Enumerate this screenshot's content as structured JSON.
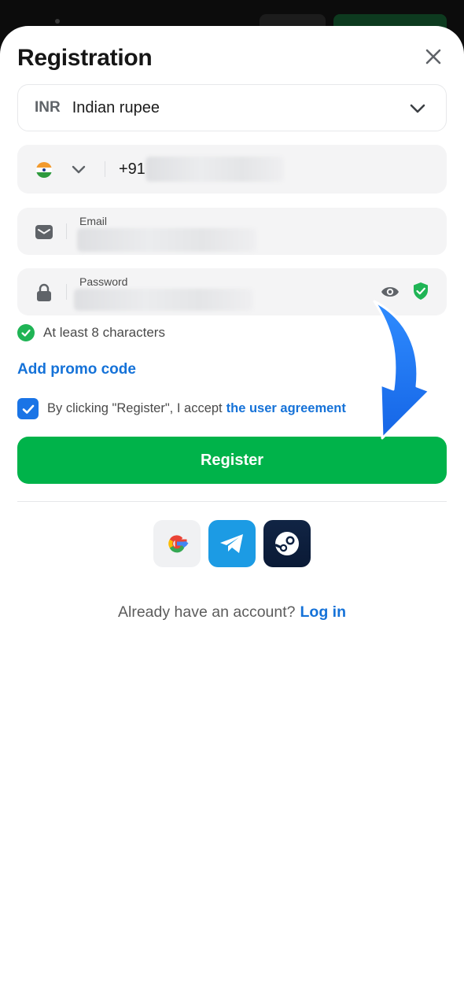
{
  "title": "Registration",
  "currency": {
    "code": "INR",
    "name": "Indian rupee"
  },
  "phone": {
    "dial_code": "+91"
  },
  "email": {
    "label": "Email"
  },
  "password": {
    "label": "Password"
  },
  "hint": {
    "text": "At least 8 characters"
  },
  "promo_label": "Add promo code",
  "agreement": {
    "text": "By clicking \"Register\", I accept",
    "link": "the user agreement",
    "checked": true
  },
  "register_label": "Register",
  "social": [
    "google-icon",
    "telegram-icon",
    "steam-icon"
  ],
  "login": {
    "prompt": "Already have an account?",
    "link": "Log in"
  },
  "colors": {
    "primary_green": "#00b34a",
    "link_blue": "#1572d8",
    "checkbox_blue": "#1a74e6",
    "arrow_blue": "#1c7cf0"
  }
}
